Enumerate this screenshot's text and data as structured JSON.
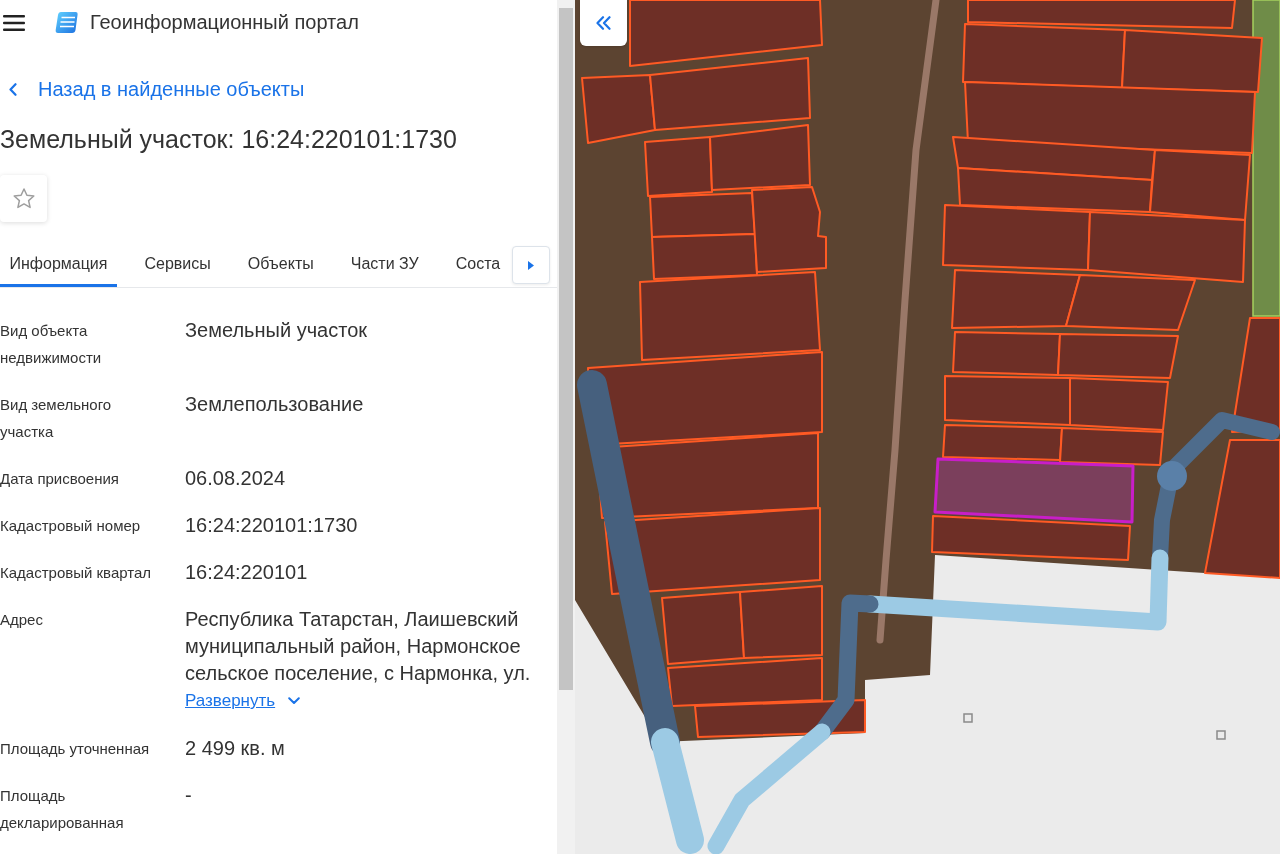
{
  "header": {
    "title": "Геоинформационный портал"
  },
  "back_link": {
    "label": "Назад в найденные объекты"
  },
  "heading": "Земельный участок: 16:24:220101:1730",
  "favorite": {
    "on": false
  },
  "tabs": [
    {
      "label": "Информация",
      "selected": true
    },
    {
      "label": "Сервисы",
      "selected": false
    },
    {
      "label": "Объекты",
      "selected": false
    },
    {
      "label": "Части ЗУ",
      "selected": false
    },
    {
      "label": "Соста",
      "selected": false
    }
  ],
  "info_rows": [
    {
      "label": "Вид объекта недвижимости",
      "value": "Земельный участок"
    },
    {
      "label": "Вид земельного участка",
      "value": "Землепользование"
    },
    {
      "label": "Дата присвоения",
      "value": "06.08.2024"
    },
    {
      "label": "Кадастровый номер",
      "value": "16:24:220101:1730"
    },
    {
      "label": "Кадастровый квартал",
      "value": "16:24:220101"
    },
    {
      "label": "Адрес",
      "value": "Республика Татарстан, Лаишевский муниципальный район, Нармонское сельское поселение, с Нармонка, ул.",
      "expand_link": "Развернуть"
    },
    {
      "label": "Площадь уточненная",
      "value": "2 499 кв. м"
    },
    {
      "label": "Площадь декларированная",
      "value": "-"
    }
  ],
  "map": {
    "parcels": [
      {
        "selected": false
      },
      {
        "selected": false
      },
      {
        "selected": false
      },
      {
        "selected": false
      },
      {
        "selected": false
      },
      {
        "selected": false
      },
      {
        "selected": false
      },
      {
        "selected": false
      },
      {
        "selected": false
      },
      {
        "selected": false
      },
      {
        "selected": false
      },
      {
        "selected": false
      },
      {
        "selected": false
      },
      {
        "selected": false
      },
      {
        "selected": false
      },
      {
        "selected": false
      },
      {
        "selected": false
      },
      {
        "selected": false
      },
      {
        "selected": false
      },
      {
        "selected": false
      },
      {
        "selected": false
      },
      {
        "selected": false
      },
      {
        "selected": false
      },
      {
        "selected": false
      },
      {
        "selected": false
      },
      {
        "selected": false
      },
      {
        "selected": false
      },
      {
        "selected": false
      },
      {
        "selected": false
      },
      {
        "selected": false
      },
      {
        "selected": false
      },
      {
        "selected": false
      },
      {
        "selected": false
      },
      {
        "selected": true
      },
      {
        "selected": false
      },
      {
        "selected": false
      },
      {
        "selected": false
      }
    ]
  }
}
